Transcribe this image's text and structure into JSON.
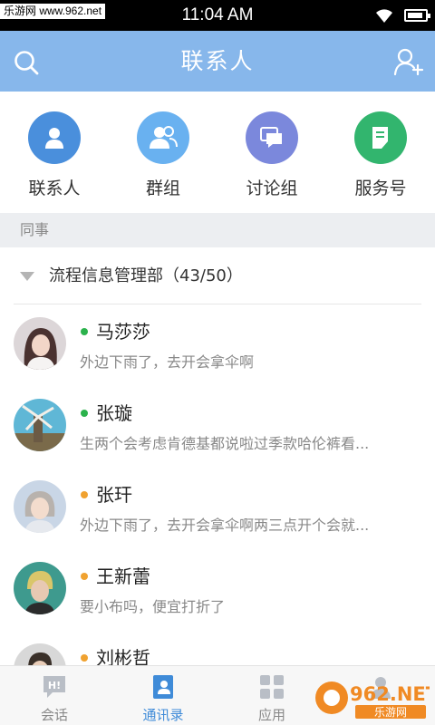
{
  "status_bar": {
    "watermark": "乐游网 www.962.net",
    "time": "11:04 AM"
  },
  "header": {
    "title": "联系人",
    "left_icon": "search-icon",
    "right_icon": "add-user-icon"
  },
  "quick_entries": [
    {
      "label": "联系人",
      "icon": "person-icon",
      "color": "#4a8fdc"
    },
    {
      "label": "群组",
      "icon": "group-icon",
      "color": "#69b1f0"
    },
    {
      "label": "讨论组",
      "icon": "discussion-icon",
      "color": "#7b88dc"
    },
    {
      "label": "服务号",
      "icon": "service-doc-icon",
      "color": "#32b56e"
    }
  ],
  "section": {
    "label": "同事"
  },
  "group": {
    "name": "流程信息管理部（43/50）"
  },
  "contacts": [
    {
      "name": "马莎莎",
      "message": "外边下雨了，去开会拿伞啊",
      "status_color": "#2bb24c"
    },
    {
      "name": "张璇",
      "message": "生两个会考虑肯德基都说啦过季款哈伦裤看...",
      "status_color": "#2bb24c"
    },
    {
      "name": "张玕",
      "message": "外边下雨了，去开会拿伞啊两三点开个会就...",
      "status_color": "#f0a230"
    },
    {
      "name": "王新蕾",
      "message": "要小布吗，便宜打折了",
      "status_color": "#f0a230"
    },
    {
      "name": "刘彬哲",
      "message": "",
      "status_color": "#f0a230"
    }
  ],
  "tabs": [
    {
      "label": "会话",
      "icon": "chat-icon",
      "active": false
    },
    {
      "label": "通讯录",
      "icon": "contacts-book-icon",
      "active": true
    },
    {
      "label": "应用",
      "icon": "apps-grid-icon",
      "active": false
    },
    {
      "label": "",
      "icon": "profile-icon",
      "active": false
    }
  ],
  "branding": {
    "logo_text": "962.NET",
    "logo_subtext": "乐游网"
  },
  "colors": {
    "header": "#87b7eb",
    "accent": "#3f8bd8",
    "online": "#2bb24c",
    "away": "#f0a230"
  }
}
